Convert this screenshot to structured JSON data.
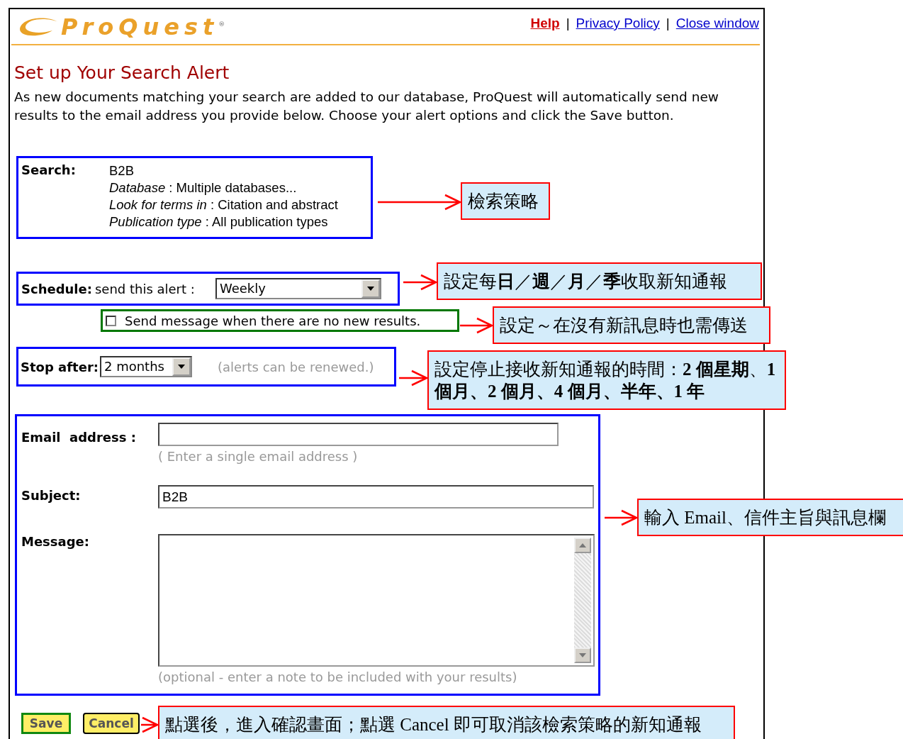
{
  "header": {
    "logo": "ProQuest$^{®}$",
    "links": [
      {
        "kind": "help",
        "label": "Help"
      },
      {
        "kind": "separator",
        "label": "|"
      },
      {
        "kind": "link",
        "label": "Privacy Policy"
      },
      {
        "kind": "separator",
        "label": "|"
      },
      {
        "kind": "link",
        "label": "Close window"
      }
    ]
  },
  "title": "Set up Your Search Alert",
  "intro": "As new documents matching your search are added to our database, ProQuest will automatically send new results to the email address you provide below. Choose your alert options and click the Save button.",
  "search": {
    "label": "Search:",
    "query": "B2B",
    "details": [
      "*Database* : Multiple databases...",
      "*Look for terms in* : Citation and abstract",
      "*Publication type* : All publication types"
    ]
  },
  "schedule": {
    "label": "Schedule:",
    "prompt": "send this alert :",
    "value": "Weekly"
  },
  "no_results_option": {
    "label": "Send message when there are no new results.",
    "checked": false
  },
  "stop_after": {
    "label": "Stop after:",
    "value": "2 months",
    "note": "(alerts can be renewed.)"
  },
  "email": {
    "label": "Email  address :",
    "hint": "( Enter a single email address )"
  },
  "subject": {
    "label": "Subject:",
    "value": "B2B"
  },
  "message": {
    "label": "Message:",
    "hint": "(optional - enter a note to be included with your results)"
  },
  "buttons": [
    {
      "kind": "save",
      "label": "Save"
    },
    {
      "kind": "cancel",
      "label": "Cancel"
    }
  ],
  "annotations": [
    {
      "text": "檢索策略"
    },
    {
      "text": "設定每**日**／**週**／**月**／**季**收取新知通報"
    },
    {
      "text": "設定～在沒有新訊息時也需傳送"
    },
    {
      "text": "設定停止接收新知通報的時間：**2 個星期**、**1 個月、2 個月、4 個月、半年、1 年**"
    },
    {
      "text": "輸入 Email、信件主旨與訊息欄"
    },
    {
      "text": "點選後，進入確認畫面；點選 Cancel 即可取消該檢索策略的新知通報"
    }
  ]
}
